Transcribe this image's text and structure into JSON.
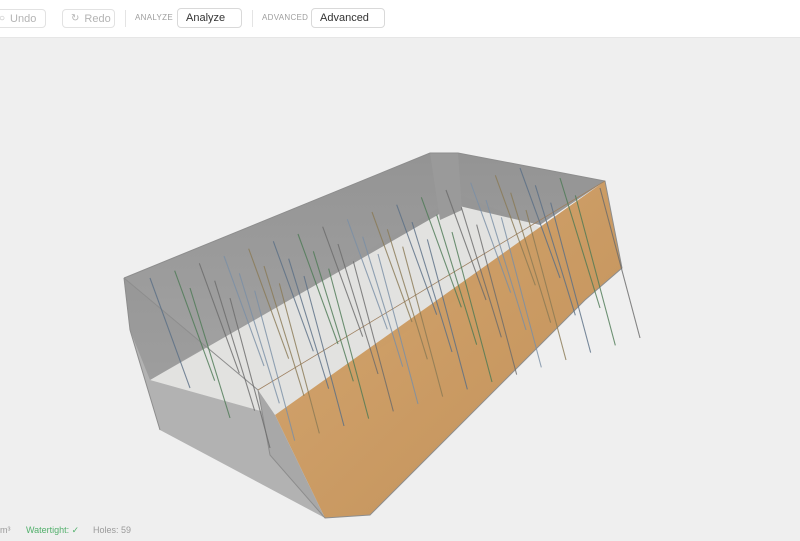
{
  "toolbar": {
    "undo_label": "Undo",
    "redo_label": "Redo",
    "analyze_group_label": "ANALYZE",
    "analyze_value": "Analyze",
    "advanced_group_label": "ADVANCED",
    "advanced_value": "Advanced"
  },
  "status": {
    "volume_unit": "m³",
    "watertight": "Watertight: ✓",
    "holes": "Holes: 59"
  },
  "colors": {
    "accent_ok": "#52b06c",
    "block_front": "#c9955a",
    "block_grey": "#8a8a8a"
  },
  "icons": {
    "undo": "undo-icon",
    "redo": "redo-icon",
    "dropdown": "chevron-down-icon"
  }
}
